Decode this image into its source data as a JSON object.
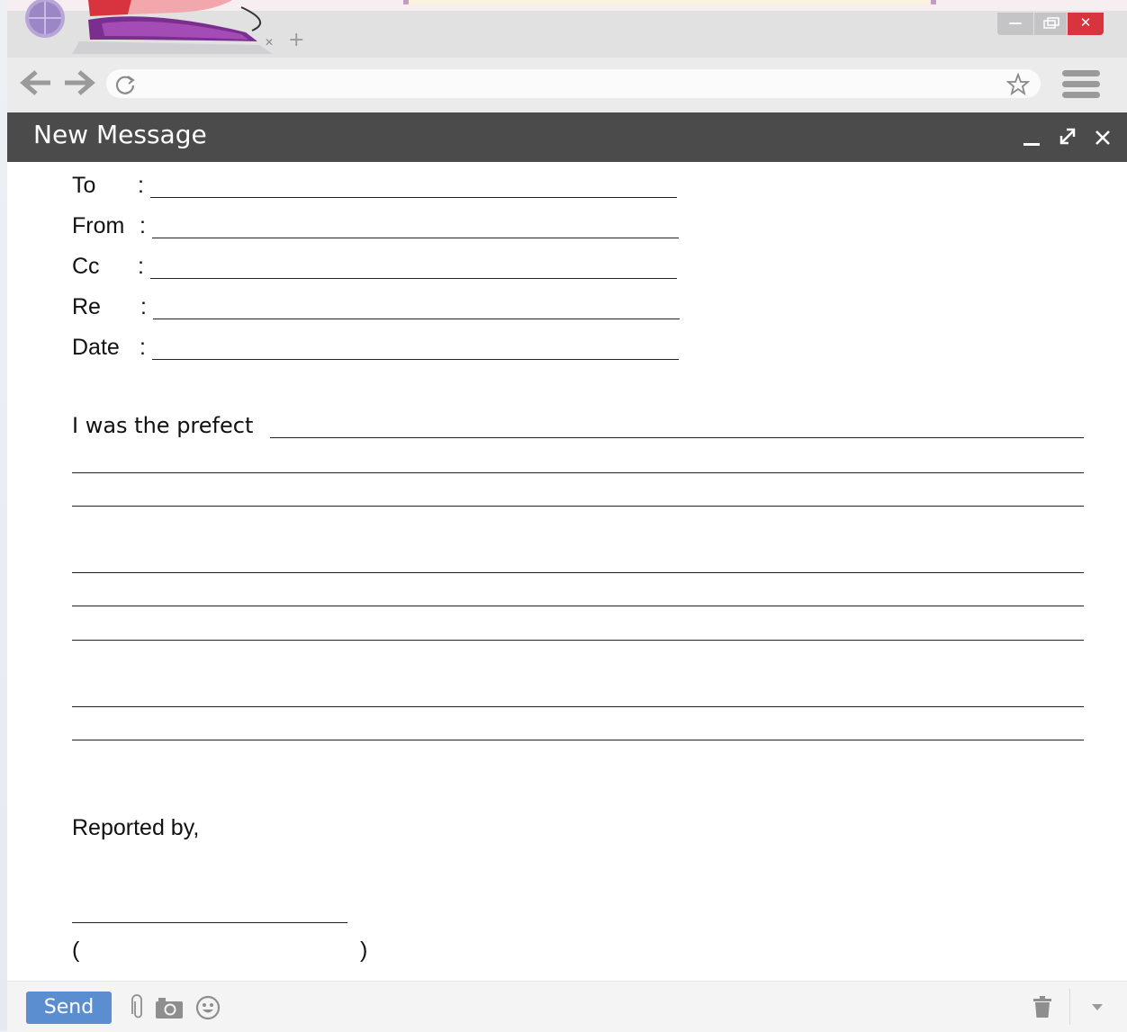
{
  "compose": {
    "title": "New Message"
  },
  "fields": [
    {
      "label": "To",
      "value": ""
    },
    {
      "label": "From",
      "value": ""
    },
    {
      "label": "Cc",
      "value": ""
    },
    {
      "label": "Re",
      "value": ""
    },
    {
      "label": "Date",
      "value": ""
    }
  ],
  "field_separator": ":",
  "body": {
    "opening": "I was the prefect",
    "closing": "Reported by,",
    "name_open_paren": "(",
    "name_close_paren": ")"
  },
  "footer": {
    "send_label": "Send"
  },
  "address_bar": {
    "value": ""
  },
  "colors": {
    "header_bg": "#4b4b4b",
    "send_button": "#5b8ed0",
    "close_button": "#d8343e",
    "chrome_bg": "#e1e1e2"
  },
  "icons": [
    "close-icon",
    "new-tab-icon",
    "minimize-icon",
    "restore-icon",
    "back-arrow-icon",
    "forward-arrow-icon",
    "reload-icon",
    "star-icon",
    "menu-icon",
    "maximize-icon",
    "attach-icon",
    "camera-icon",
    "emoji-icon",
    "trash-icon",
    "chevron-down-icon"
  ]
}
